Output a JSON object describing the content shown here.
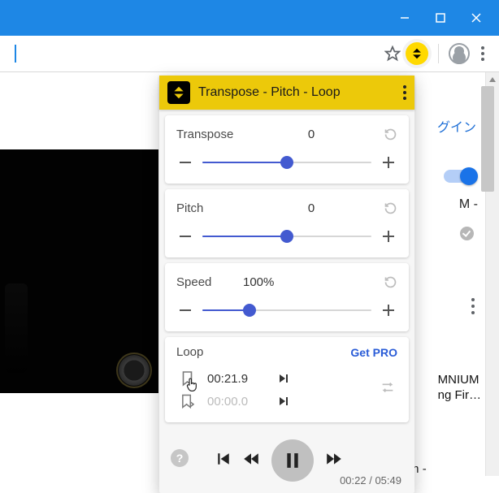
{
  "bg": {
    "login_text": "グイン",
    "line1": "M -",
    "rec1_l1": "MNIUM",
    "rec1_l2": "ng Fir…",
    "rec_title": "Omnium Gatherum -"
  },
  "popup": {
    "title": "Transpose - Pitch - Loop",
    "transpose": {
      "label": "Transpose",
      "value": "0",
      "slider_percent": 50
    },
    "pitch": {
      "label": "Pitch",
      "value": "0",
      "slider_percent": 50
    },
    "speed": {
      "label": "Speed",
      "value": "100%",
      "slider_percent": 28
    },
    "loop": {
      "label": "Loop",
      "get_pro": "Get PRO",
      "start_time": "00:21.9",
      "end_time": "00:00.0"
    },
    "transport": {
      "current": "00:22",
      "total": "05:49"
    }
  }
}
